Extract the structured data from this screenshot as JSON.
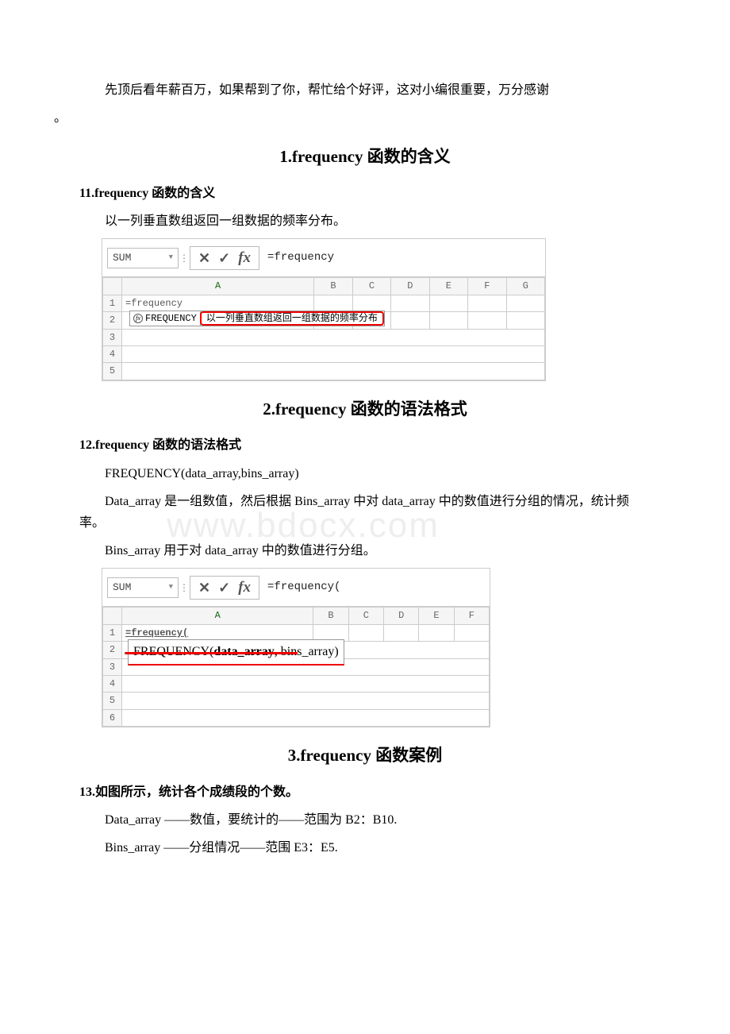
{
  "intro_line": "先顶后看年薪百万，如果帮到了你，帮忙给个好评，这对小编很重要，万分感谢",
  "s1": {
    "title": "1.frequency 函数的含义",
    "sub": "11.frequency 函数的含义",
    "desc": "以一列垂直数组返回一组数据的频率分布。",
    "fig": {
      "namebox": "SUM",
      "formula": "=frequency",
      "cols": [
        "A",
        "B",
        "C",
        "D",
        "E",
        "F",
        "G"
      ],
      "row1_cell": "=frequency",
      "sugg_name": "FREQUENCY",
      "sugg_desc": "以一列垂直数组返回一组数据的频率分布"
    }
  },
  "s2": {
    "title": "2.frequency 函数的语法格式",
    "sub": "12.frequency 函数的语法格式",
    "line1": "FREQUENCY(data_array,bins_array)",
    "line2": "Data_array 是一组数值，然后根据 Bins_array 中对 data_array 中的数值进行分组的情况，统计频率。",
    "line3": "Bins_array 用于对 data_array 中的数值进行分组。",
    "fig": {
      "namebox": "SUM",
      "formula": "=frequency(",
      "cols": [
        "A",
        "B",
        "C",
        "D",
        "E",
        "F"
      ],
      "row1_cell": "=frequency(",
      "syntax_bold": "data_array",
      "syntax_rest": ", bins_array)",
      "syntax_fn": "FREQUENCY("
    }
  },
  "s3": {
    "title": "3.frequency 函数案例",
    "sub": "13.如图所示，统计各个成绩段的个数。",
    "line1": "Data_array ——数值，要统计的——范围为 B2：B10.",
    "line2": "Bins_array ——分组情况——范围 E3：E5."
  },
  "watermark": "www.bdocx.com"
}
